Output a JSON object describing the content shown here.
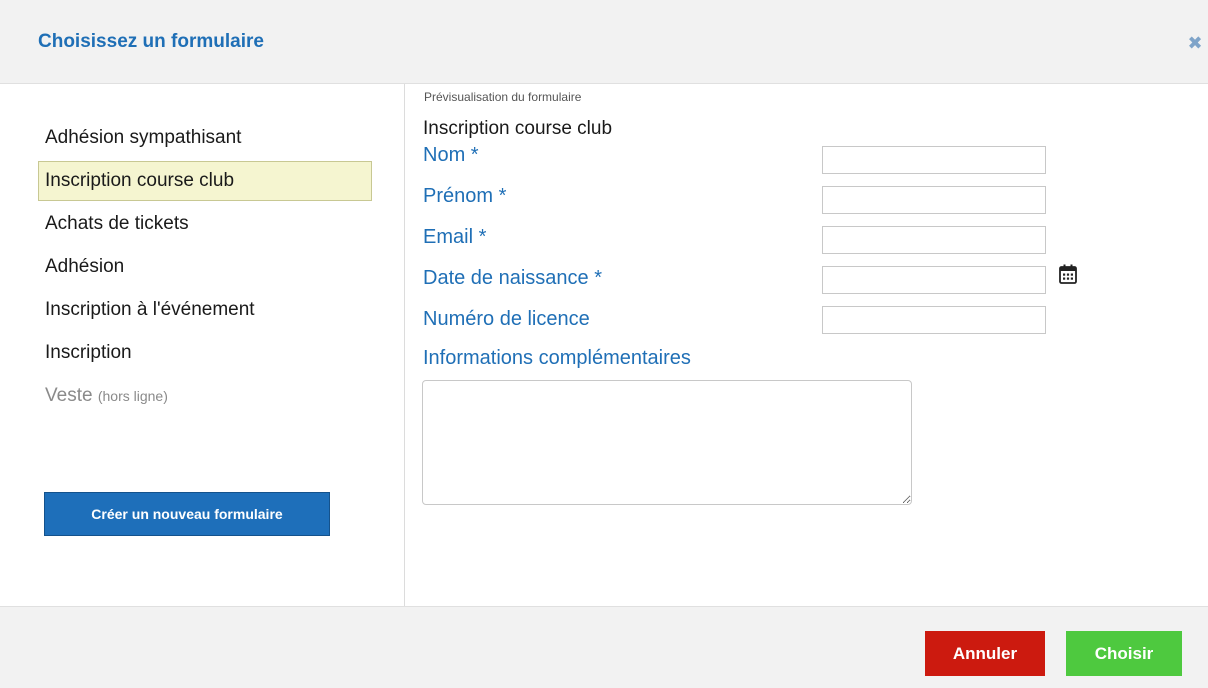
{
  "dialog": {
    "title": "Choisissez un formulaire",
    "close_icon": "close-icon"
  },
  "sidebar": {
    "items": [
      {
        "label": "Adhésion sympathisant",
        "selected": false,
        "offline": false
      },
      {
        "label": "Inscription course club",
        "selected": true,
        "offline": false
      },
      {
        "label": "Achats de tickets",
        "selected": false,
        "offline": false
      },
      {
        "label": "Adhésion",
        "selected": false,
        "offline": false
      },
      {
        "label": "Inscription à l'événement",
        "selected": false,
        "offline": false
      },
      {
        "label": "Inscription",
        "selected": false,
        "offline": false
      },
      {
        "label": "Veste",
        "selected": false,
        "offline": true,
        "tag": "(hors ligne)"
      }
    ],
    "create_button": "Créer un nouveau formulaire"
  },
  "preview": {
    "caption": "Prévisualisation du formulaire",
    "form_title": "Inscription course club",
    "fields": [
      {
        "label": "Nom *",
        "value": ""
      },
      {
        "label": "Prénom *",
        "value": ""
      },
      {
        "label": "Email *",
        "value": ""
      },
      {
        "label": "Date de naissance *",
        "value": "",
        "icon": "calendar-icon"
      },
      {
        "label": "Numéro de licence",
        "value": ""
      }
    ],
    "extra_label": "Informations complémentaires",
    "extra_value": ""
  },
  "footer": {
    "cancel_label": "Annuler",
    "choose_label": "Choisir"
  },
  "colors": {
    "accent": "#1f6fb6",
    "cancel": "#cc1a0f",
    "choose": "#4ec93f",
    "selected_bg": "#f5f5d0"
  }
}
